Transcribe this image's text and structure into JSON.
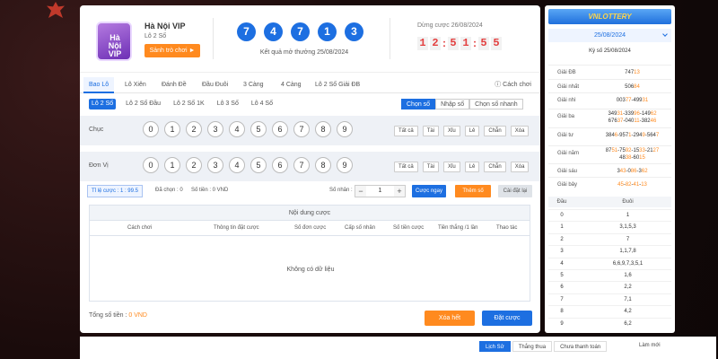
{
  "game": {
    "logo_line1": "Hà Nội",
    "logo_line2": "VIP",
    "name": "Hà Nội VIP",
    "subname": "Lô 2 Số",
    "play_btn": "Sảnh trò chơi ►"
  },
  "result": {
    "balls": [
      "7",
      "4",
      "7",
      "1",
      "3"
    ],
    "label": "Kết quả mở thưởng 25/08/2024"
  },
  "timer": {
    "label": "Dừng cược 26/08/2024",
    "digits": [
      "1",
      "2",
      "5",
      "1",
      "5",
      "5"
    ]
  },
  "tabs": [
    "Bao Lô",
    "Lô Xiên",
    "Đánh Đề",
    "Đầu Đuôi",
    "3 Càng",
    "4 Càng",
    "Lô 2 Số Giải ĐB"
  ],
  "howto": "ⓘ Cách chơi",
  "subtabs": [
    "Lô 2 Số",
    "Lô 2 Số Đầu",
    "Lô 2 Số 1K",
    "Lô 3 Số",
    "Lô 4 Số"
  ],
  "modes": [
    "Chọn số",
    "Nhập số",
    "Chọn số nhanh"
  ],
  "rows": [
    {
      "label": "Chục"
    },
    {
      "label": "Đơn Vị"
    }
  ],
  "digits": [
    "0",
    "1",
    "2",
    "3",
    "4",
    "5",
    "6",
    "7",
    "8",
    "9"
  ],
  "quick": [
    "Tất cả",
    "Tài",
    "Xỉu",
    "Lẻ",
    "Chẵn",
    "Xóa"
  ],
  "controls": {
    "rate": "Tỉ lệ cược : 1 : 99.5",
    "picked": "Đã chọn : 0",
    "money": "Số tiền : 0 VND",
    "multiplier_label": "Số nhân :",
    "multiplier": "1",
    "minus": "−",
    "plus": "+",
    "quick_bet": "Cược ngay",
    "add_number": "Thêm số",
    "reset": "Cài đặt lại"
  },
  "table": {
    "title": "Nội dung cược",
    "headers": [
      "Cách chơi",
      "Thông tin đặt cược",
      "Số đơn cược",
      "Cấp số nhân",
      "Số tiền cược",
      "Tiền thắng /1 lần",
      "Thao tác"
    ],
    "empty": "Không có dữ liệu"
  },
  "footer": {
    "total_label": "Tổng số tiền :",
    "total_value": "0 VND",
    "clear": "Xóa hết",
    "submit": "Đặt cược"
  },
  "sidebar": {
    "logo": "VNLOTTERY",
    "date": "25/08/2024",
    "kyso": "Kỳ số 25/08/2024",
    "prizes": [
      {
        "label": "Giải ĐB",
        "lines": [
          [
            "747",
            "13"
          ]
        ]
      },
      {
        "label": "Giải nhất",
        "lines": [
          [
            "506",
            "84"
          ]
        ]
      },
      {
        "label": "Giải nhì",
        "lines": [
          [
            "003",
            "77"
          ],
          [
            "-499",
            "31"
          ]
        ]
      },
      {
        "label": "Giải ba",
        "lines": [
          [
            "349",
            "31"
          ],
          [
            "-339",
            "96"
          ],
          [
            "-149",
            "62"
          ]
        ],
        "lines2": [
          [
            "676",
            "37"
          ],
          [
            "-040",
            "11"
          ],
          [
            "-382",
            "46"
          ]
        ]
      },
      {
        "label": "Giải tư",
        "lines": [
          [
            "384",
            "6"
          ],
          [
            "-957",
            "1"
          ],
          [
            "-294",
            "9"
          ],
          [
            "-564",
            "7"
          ]
        ]
      },
      {
        "label": "Giải năm",
        "lines": [
          [
            "87",
            "51"
          ],
          [
            "-75",
            "92"
          ],
          [
            "-15",
            "33"
          ],
          [
            "-21",
            "27"
          ]
        ],
        "lines2": [
          [
            "48",
            "38"
          ],
          [
            "-60",
            "15"
          ]
        ]
      },
      {
        "label": "Giải sáu",
        "lines": [
          [
            "3",
            "43"
          ],
          [
            "-0",
            "86"
          ],
          [
            "-3",
            "62"
          ]
        ]
      },
      {
        "label": "Giải bảy",
        "lines": [
          [
            "",
            "45"
          ],
          [
            "-",
            "82"
          ],
          [
            "-",
            "41"
          ],
          [
            "-",
            "13"
          ]
        ]
      }
    ],
    "dd_head": [
      "Đầu",
      "Đuôi"
    ],
    "dd": [
      [
        "0",
        "1"
      ],
      [
        "1",
        "3,1,5,3"
      ],
      [
        "2",
        "7"
      ],
      [
        "3",
        "1,1,7,8"
      ],
      [
        "4",
        "6,6,9,7,3,5,1"
      ],
      [
        "5",
        "1,6"
      ],
      [
        "6",
        "2,2"
      ],
      [
        "7",
        "7,1"
      ],
      [
        "8",
        "4,2"
      ],
      [
        "9",
        "6,2"
      ]
    ]
  },
  "bottom": {
    "tabs": [
      "Lịch Sử",
      "Thắng thua",
      "Chưa thanh toán"
    ],
    "refresh": "Làm mới"
  }
}
